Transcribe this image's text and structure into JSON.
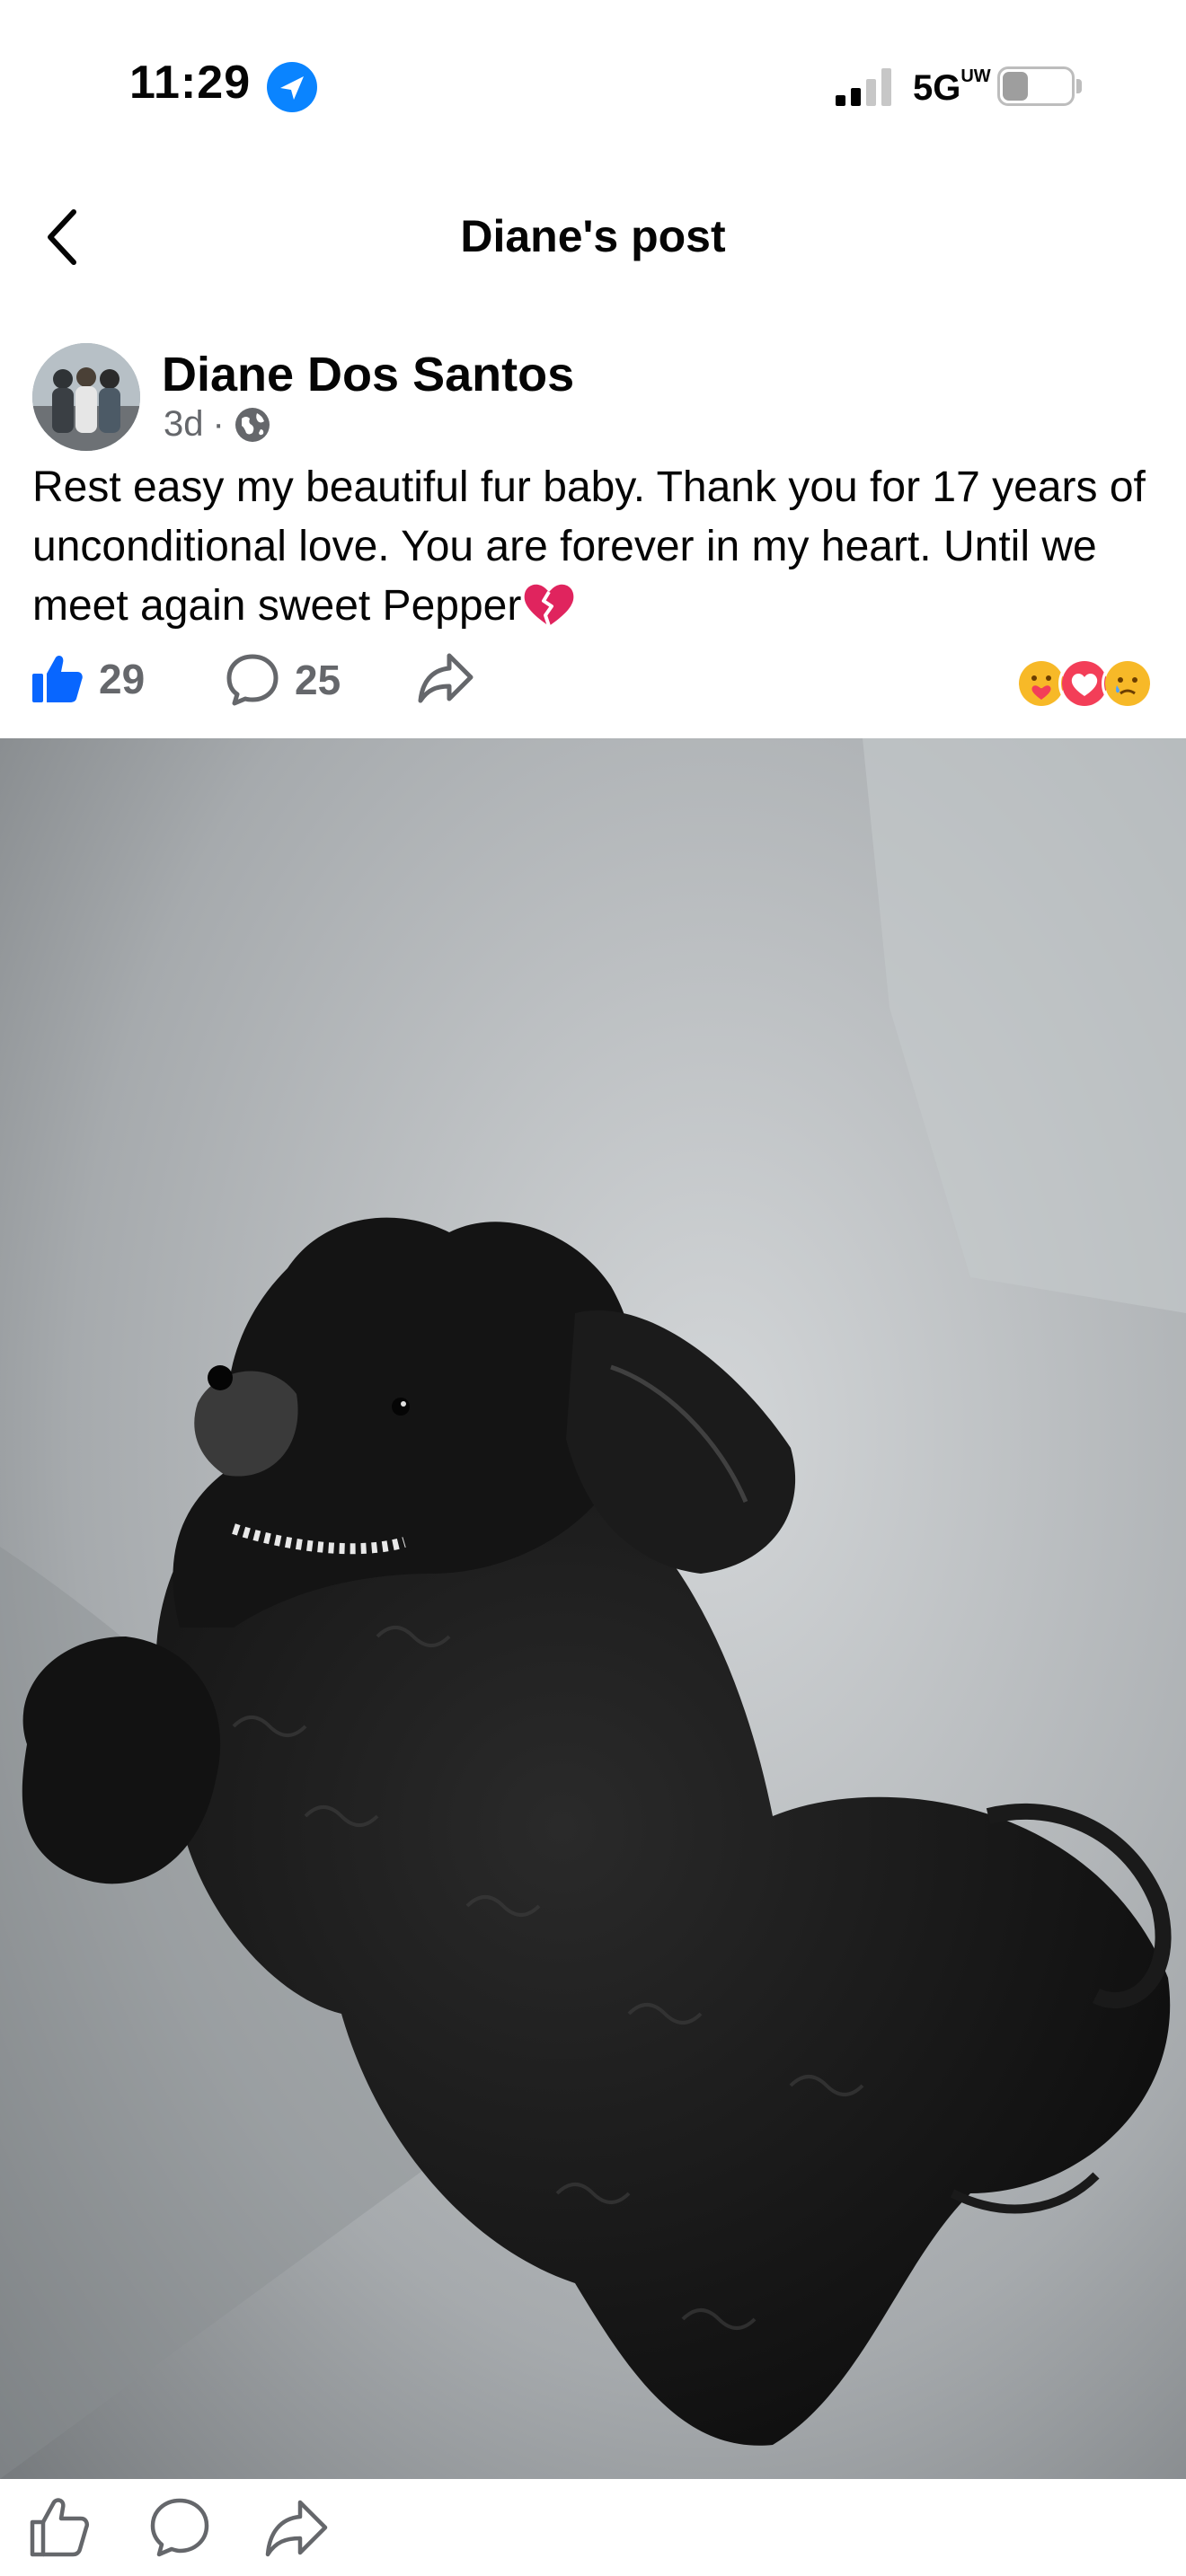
{
  "status_bar": {
    "time": "11:29",
    "network": "5G",
    "network_sup": "UW",
    "battery_level": "2"
  },
  "header": {
    "title": "Diane's post",
    "back_icon": "chevron-left-icon"
  },
  "post": {
    "author": "Diane Dos Santos",
    "age": "3d",
    "separator": "·",
    "privacy_icon": "globe-icon",
    "text": "Rest easy my beautiful fur baby. Thank you for 17 years of unconditional love.  You are forever in my heart.   Until we meet again sweet Pepper",
    "text_emoji": "broken-heart-icon",
    "likes_count": "29",
    "comments_count": "25",
    "reactions": [
      "care-reaction-icon",
      "love-reaction-icon",
      "sad-reaction-icon"
    ],
    "photo": "black-dog-photo"
  },
  "bottom_bar": {
    "icons": [
      "like-icon",
      "comment-icon",
      "share-icon"
    ]
  },
  "colors": {
    "facebook_blue": "#0866ff",
    "secondary_text": "#65676b",
    "love_red": "#f33e58",
    "reaction_yellow": "#f7b928"
  }
}
